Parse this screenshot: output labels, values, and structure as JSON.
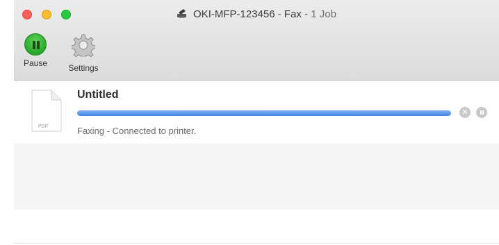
{
  "window": {
    "printer_name": "OKI-MFP-123456",
    "separator": " - ",
    "queue_type": "Fax",
    "job_count": "1 Job"
  },
  "toolbar": {
    "pause_label": "Pause",
    "settings_label": "Settings"
  },
  "jobs": [
    {
      "name": "Untitled",
      "file_type": "PDF",
      "status": "Faxing - Connected to printer.",
      "progress": 1.0
    }
  ],
  "colors": {
    "progress": "#3f87e8",
    "pause_green": "#27a829"
  },
  "icons": [
    "printer-icon",
    "pause-icon",
    "gear-icon",
    "document-icon",
    "cancel-icon",
    "hold-icon"
  ]
}
